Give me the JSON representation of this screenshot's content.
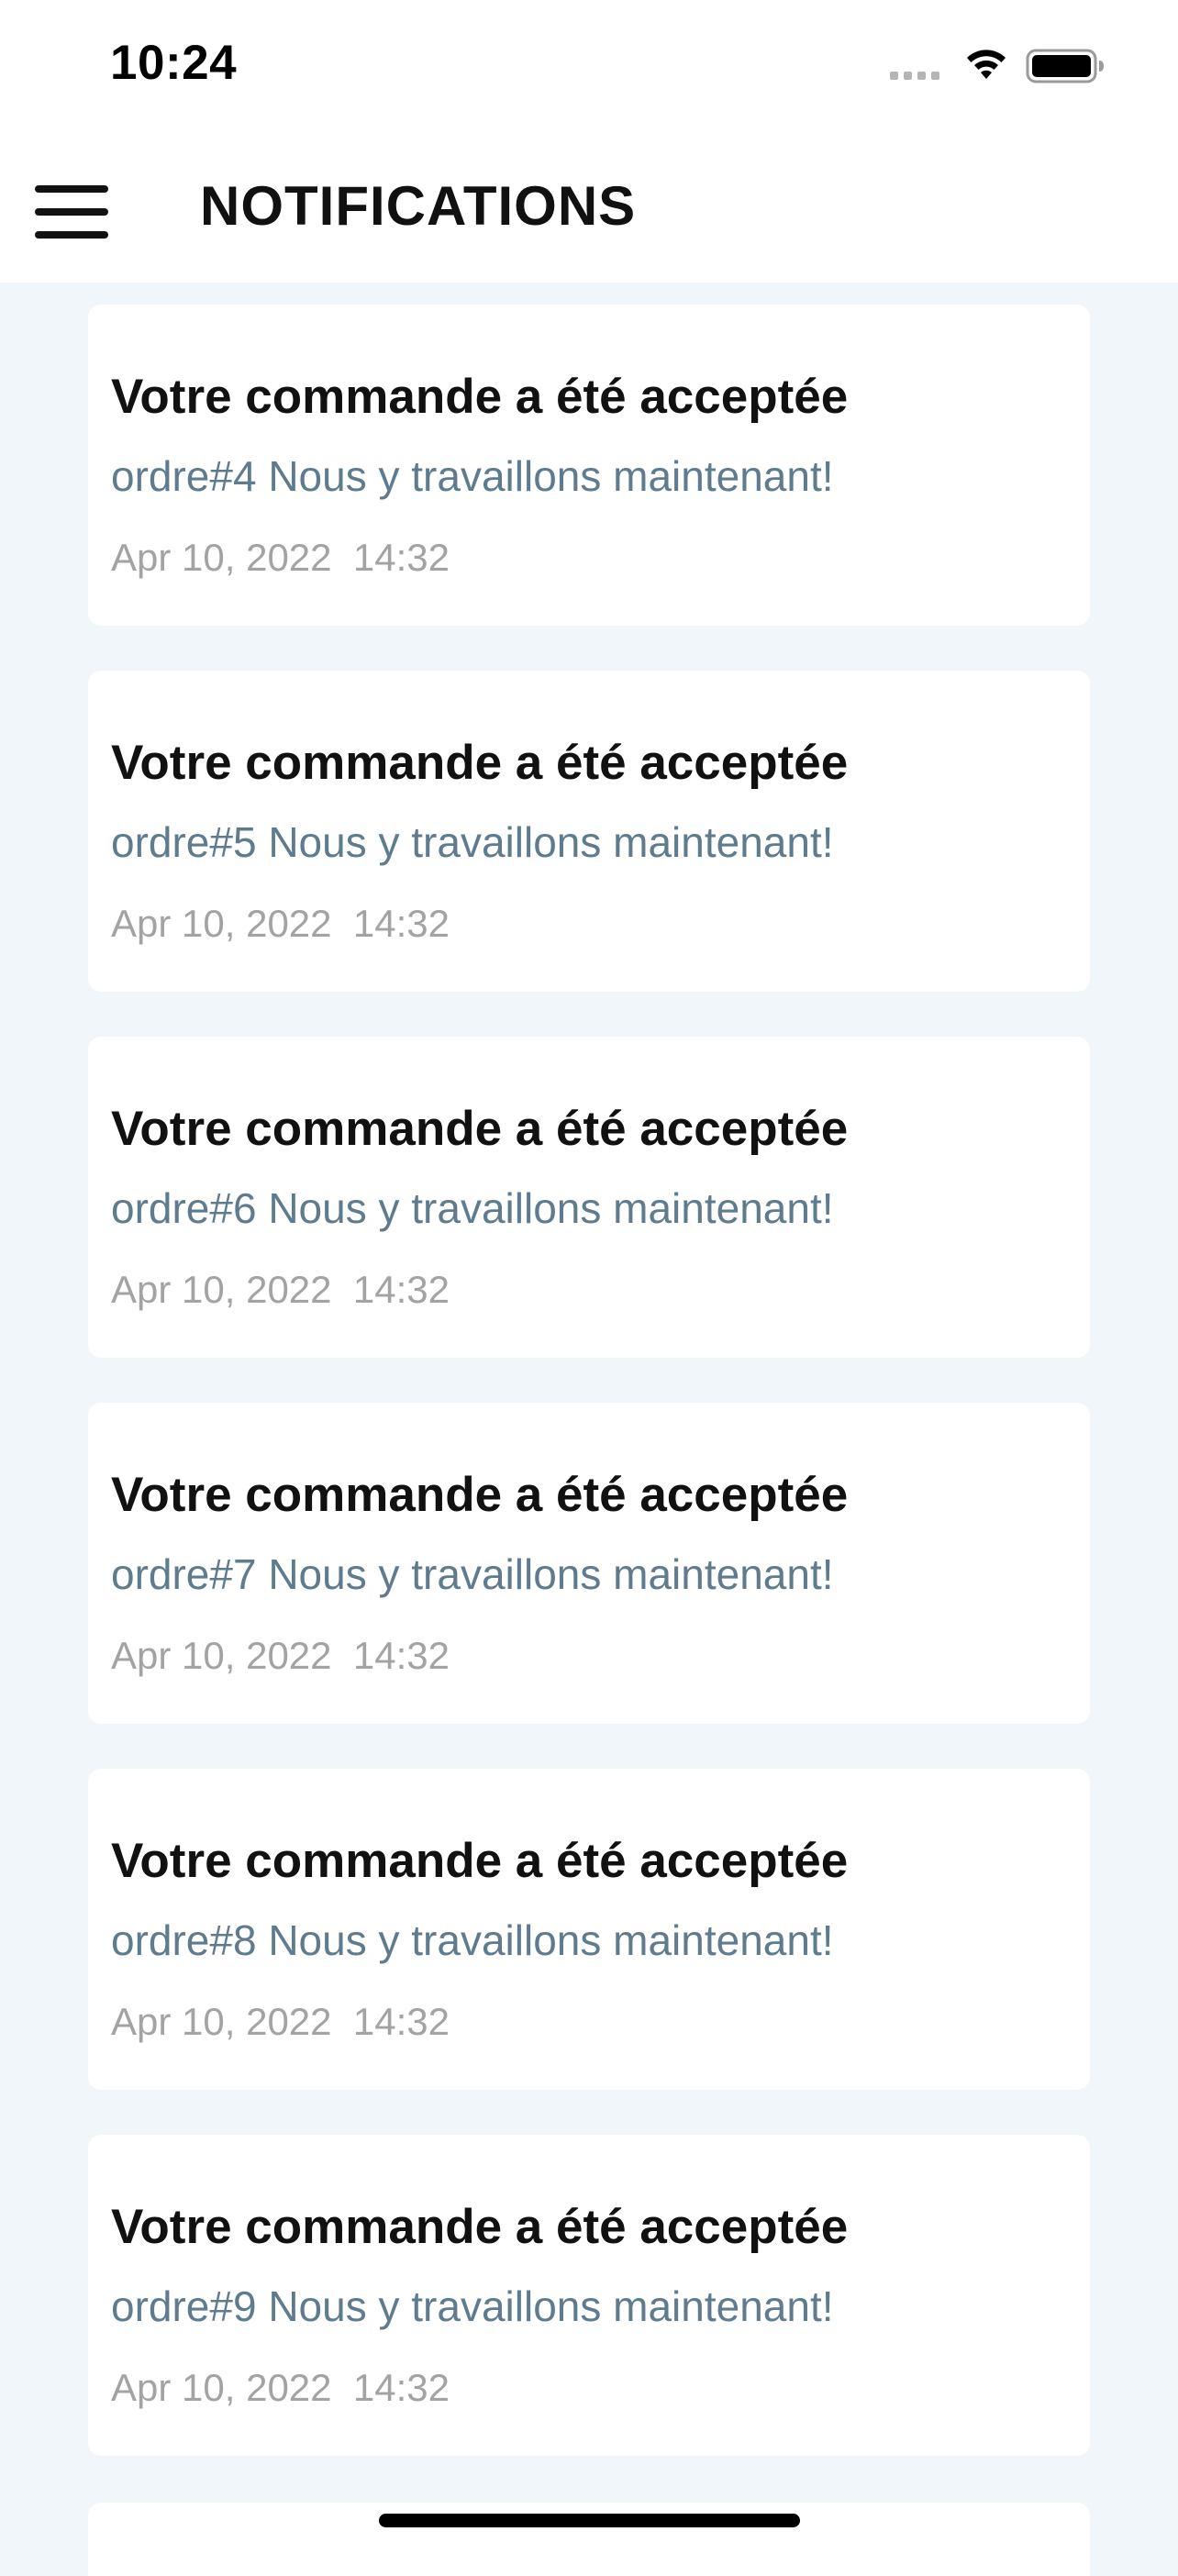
{
  "status_bar": {
    "time": "10:24"
  },
  "header": {
    "title": "NOTIFICATIONS",
    "menu_icon": "hamburger-menu-icon"
  },
  "notifications": [
    {
      "title": "Votre commande a été acceptée",
      "message": "ordre#4 Nous y travaillons maintenant!",
      "date": "Apr 10, 2022  14:32"
    },
    {
      "title": "Votre commande a été acceptée",
      "message": "ordre#5 Nous y travaillons maintenant!",
      "date": "Apr 10, 2022  14:32"
    },
    {
      "title": "Votre commande a été acceptée",
      "message": "ordre#6 Nous y travaillons maintenant!",
      "date": "Apr 10, 2022  14:32"
    },
    {
      "title": "Votre commande a été acceptée",
      "message": "ordre#7 Nous y travaillons maintenant!",
      "date": "Apr 10, 2022  14:32"
    },
    {
      "title": "Votre commande a été acceptée",
      "message": "ordre#8 Nous y travaillons maintenant!",
      "date": "Apr 10, 2022  14:32"
    },
    {
      "title": "Votre commande a été acceptée",
      "message": "ordre#9 Nous y travaillons maintenant!",
      "date": "Apr 10, 2022  14:32"
    }
  ],
  "colors": {
    "background": "#f0f6fa",
    "card": "#ffffff",
    "message_text": "#5e7c8e",
    "date_text": "#a3a3a3"
  }
}
